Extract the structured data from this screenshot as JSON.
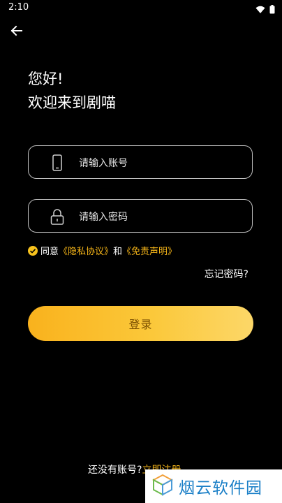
{
  "status_bar": {
    "time": "2:10"
  },
  "greeting": {
    "line1": "您好!",
    "line2": "欢迎来到剧喵"
  },
  "account_field": {
    "placeholder": "请输入账号"
  },
  "password_field": {
    "placeholder": "请输入密码"
  },
  "agreement": {
    "prefix": "同意",
    "privacy_link": "《隐私协议》",
    "and": "和",
    "disclaimer_link": "《免责声明》",
    "checked": true
  },
  "forgot_password": "忘记密码?",
  "login_button": "登录",
  "register": {
    "prompt": "还没有账号?",
    "link": "立即注册"
  },
  "watermark": {
    "text": "烟云软件园"
  },
  "colors": {
    "accent": "#f7b618",
    "background": "#000000"
  }
}
